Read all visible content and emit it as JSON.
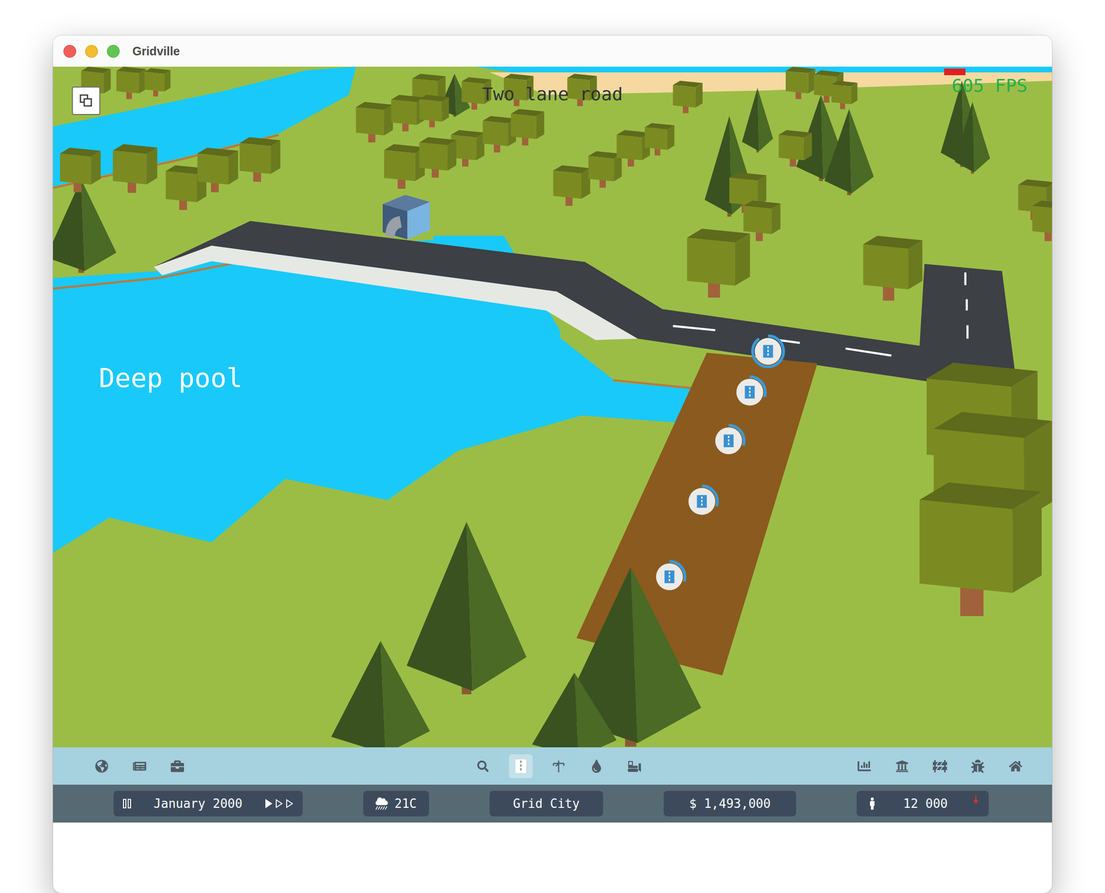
{
  "window": {
    "title": "Gridville"
  },
  "overlay": {
    "tool": "Two lane road",
    "fps": "605 FPS",
    "label": "Deep pool"
  },
  "construction": [
    {
      "level": 0.9
    },
    {
      "level": 0.3
    },
    {
      "level": 0.3
    },
    {
      "level": 0.3
    },
    {
      "level": 0.3
    }
  ],
  "toolbar": {
    "left": [
      {
        "kind": "globe",
        "selected": false
      },
      {
        "kind": "news",
        "selected": false
      },
      {
        "kind": "briefcase",
        "selected": false
      }
    ],
    "center": [
      {
        "kind": "search",
        "selected": false
      },
      {
        "kind": "road",
        "selected": true
      },
      {
        "kind": "power",
        "selected": false
      },
      {
        "kind": "water",
        "selected": false
      },
      {
        "kind": "bulldozer",
        "selected": false
      }
    ],
    "right": [
      {
        "kind": "chart",
        "selected": false
      },
      {
        "kind": "bank",
        "selected": false
      },
      {
        "kind": "barrier",
        "selected": false
      },
      {
        "kind": "bug",
        "selected": false
      },
      {
        "kind": "home",
        "selected": false
      }
    ]
  },
  "status_bar": {
    "date": "January 2000",
    "speeds": [
      {
        "selected": true
      },
      {
        "selected": false
      },
      {
        "selected": false
      }
    ],
    "weather": "21C",
    "city": "Grid City",
    "money": "$ 1,493,000",
    "population": "12 000",
    "trend": "down"
  }
}
